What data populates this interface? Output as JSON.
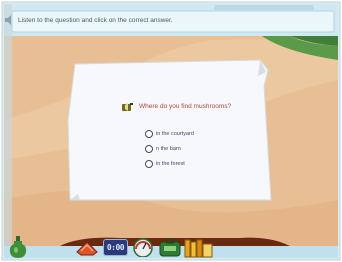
{
  "instruction": "Listen to the question and click on the correct answer.",
  "question": "Where do you find mushrooms?",
  "options": [
    {
      "label": "in the courtyard"
    },
    {
      "label": "n the barn"
    },
    {
      "label": "in the forest"
    }
  ],
  "toolbar": {
    "clock_display": "0:00"
  },
  "colors": {
    "sky": "#cfe9f2",
    "ground": "#e8bf94",
    "paper": "#f7f8fb",
    "green_field": "#3f7f3a",
    "question_text": "#b0453a"
  }
}
